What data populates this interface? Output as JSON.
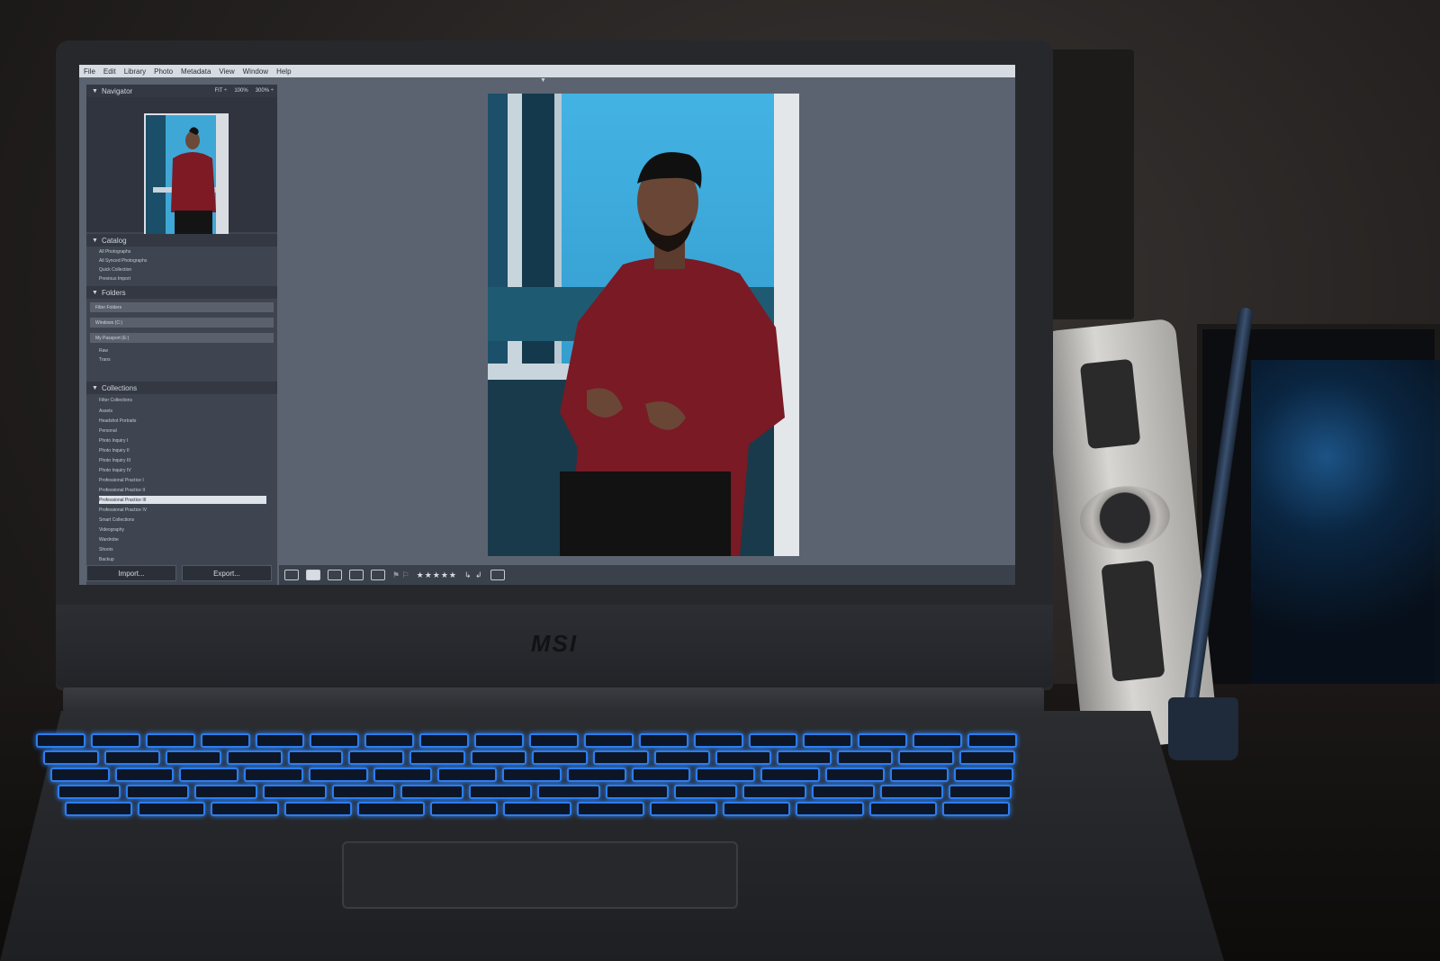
{
  "brand": {
    "logo_text": "MSI"
  },
  "menu": [
    "File",
    "Edit",
    "Library",
    "Photo",
    "Metadata",
    "View",
    "Window",
    "Help"
  ],
  "navigator": {
    "title": "Navigator",
    "zoom_options": [
      "FIT ÷",
      "100%",
      "300% ÷"
    ]
  },
  "catalog": {
    "title": "Catalog",
    "items": [
      "All Photographs",
      "All Synced Photographs",
      "Quick Collection",
      "Previous Import"
    ]
  },
  "folders": {
    "title": "Folders",
    "filter": "Filter Folders",
    "volumes": [
      "Windows (C:)",
      "My Passport (E:)"
    ],
    "items": [
      "Raw",
      "Trans"
    ]
  },
  "collections": {
    "title": "Collections",
    "filter": "Filter Collections",
    "items": [
      "Assets",
      "Headshot Portraits",
      "Personal",
      "Photo Inquiry I",
      "Photo Inquiry II",
      "Photo Inquiry III",
      "Photo Inquiry IV",
      "Professional Practice I",
      "Professional Practice II",
      "Professional Practice III",
      "Professional Practice IV",
      "Smart Collections",
      "Videography",
      "Wardrobe",
      "Shoots",
      "Backup"
    ],
    "selected_index": 9
  },
  "buttons": {
    "import": "Import...",
    "export": "Export..."
  },
  "toolbar": {
    "rating": "★★★★★",
    "flags": "⚑ ⚐",
    "rotate": "↳ ↲"
  },
  "colors": {
    "accent": "#2c7df0",
    "panel": "#3f4550",
    "background": "#5c6370"
  }
}
